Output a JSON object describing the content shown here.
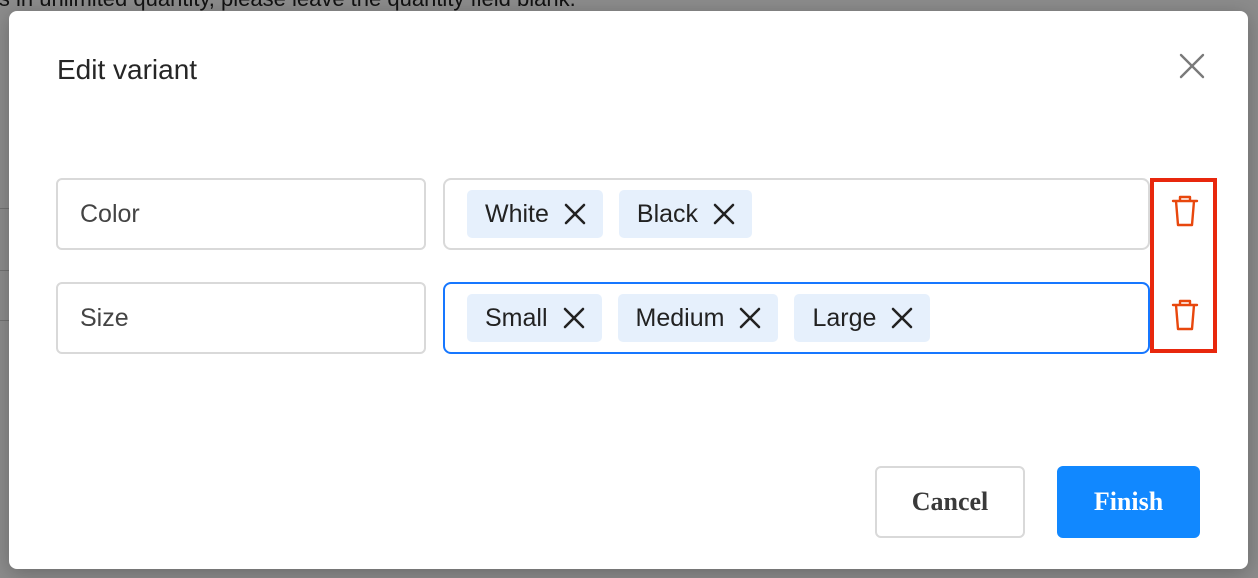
{
  "background": {
    "text": "is in unlimited quantity, please leave the quantity field blank."
  },
  "modal": {
    "title": "Edit variant",
    "close_icon": "close-icon",
    "rows": [
      {
        "name_value": "Color",
        "tags": [
          "White",
          "Black"
        ],
        "delete_icon": "trash-icon"
      },
      {
        "name_value": "Size",
        "tags": [
          "Small",
          "Medium",
          "Large"
        ],
        "delete_icon": "trash-icon"
      }
    ],
    "cancel_label": "Cancel",
    "finish_label": "Finish"
  },
  "colors": {
    "primary": "#1188ff",
    "danger": "#e8470d",
    "highlight": "#e8270d",
    "tag_bg": "#e6f0fc",
    "focus_border": "#1677ff"
  }
}
